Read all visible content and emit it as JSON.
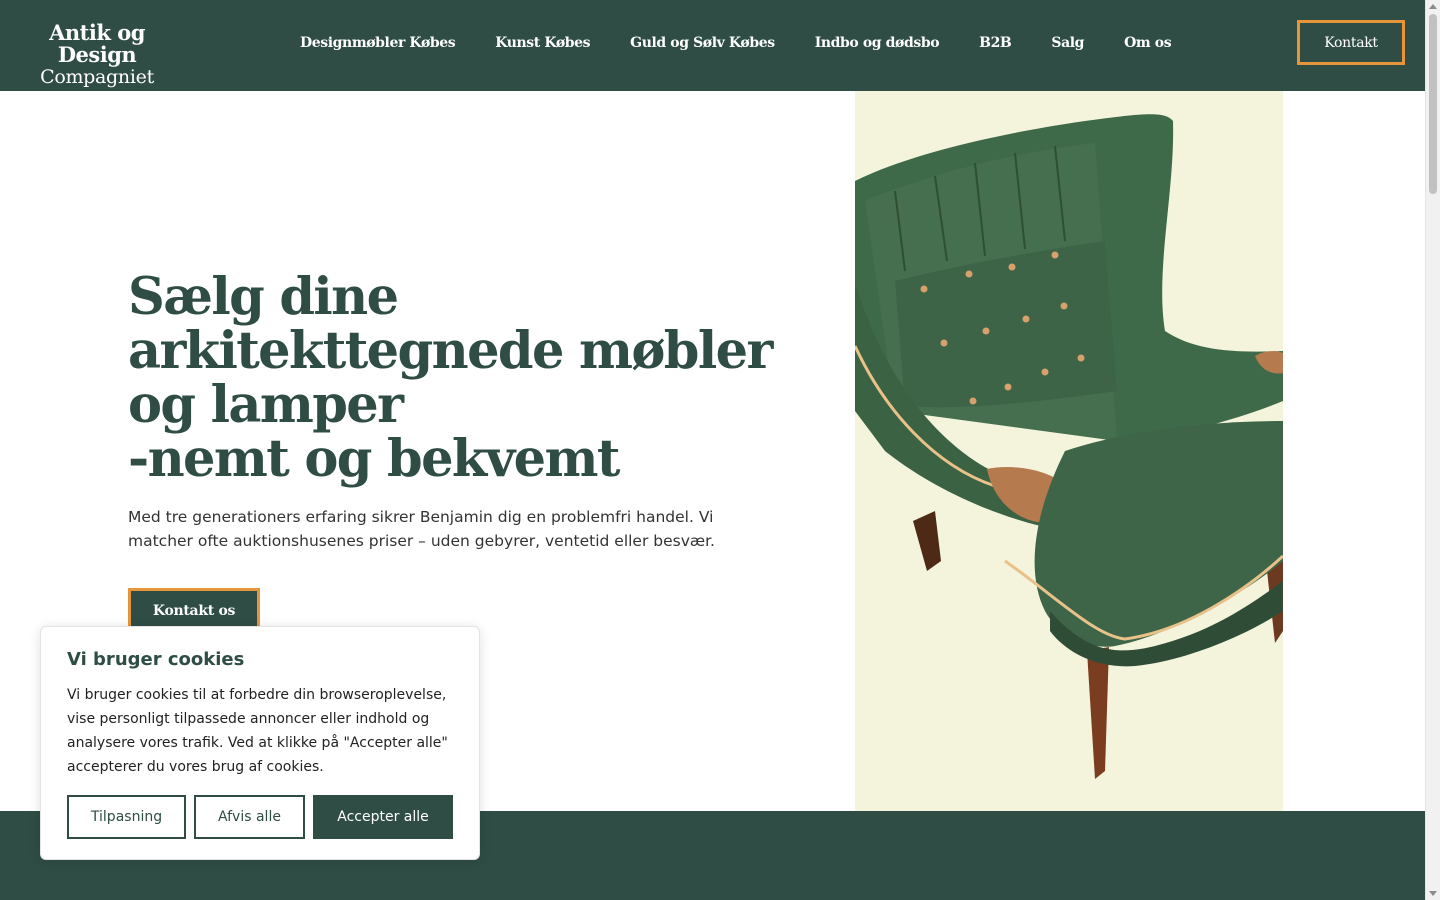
{
  "header": {
    "logo": {
      "line1": "Antik og Design",
      "line2": "Compagniet"
    },
    "nav": [
      "Designmøbler Købes",
      "Kunst Købes",
      "Guld og Sølv Købes",
      "Indbo og dødsbo",
      "B2B",
      "Salg",
      "Om os"
    ],
    "cta_label": "Kontakt"
  },
  "hero": {
    "title_lines": [
      "Sælg dine",
      "arkitekttegnede møbler",
      "og lamper",
      "-nemt og bekvemt"
    ],
    "description": "Med tre generationers erfaring sikrer Benjamin dig en problemfri handel. Vi matcher ofte auktionshusenes priser – uden gebyrer, ventetid eller besvær.",
    "button_label": "Kontakt os",
    "image_icon": "armchair-image"
  },
  "cookie": {
    "title": "Vi bruger cookies",
    "text": "Vi bruger cookies til at forbedre din browseroplevelse, vise personligt tilpassede annoncer eller indhold og analysere vores trafik. Ved at klikke på \"Accepter alle\" accepterer du vores brug af cookies.",
    "customize_label": "Tilpasning",
    "reject_label": "Afvis alle",
    "accept_label": "Accepter alle"
  },
  "colors": {
    "brand_green": "#2f4d45",
    "accent_orange": "#e6953a",
    "image_bg": "#f4f4dc"
  }
}
